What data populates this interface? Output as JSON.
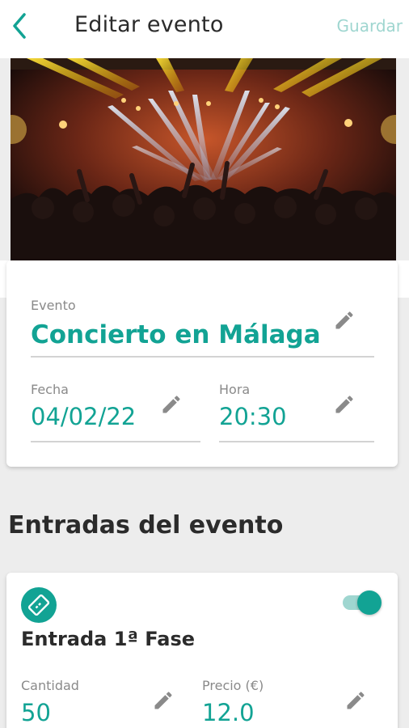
{
  "header": {
    "back_icon": "chevron-left-icon",
    "title": "Editar evento",
    "save_label": "Guardar"
  },
  "hero": {
    "alt": "concert-photo"
  },
  "event": {
    "name_label": "Evento",
    "name_value": "Concierto en Málaga",
    "date_label": "Fecha",
    "date_value": "04/02/22",
    "time_label": "Hora",
    "time_value": "20:30"
  },
  "tickets_section": {
    "title": "Entradas del evento",
    "tickets": [
      {
        "name": "Entrada 1ª Fase",
        "enabled": true,
        "quantity_label": "Cantidad",
        "quantity_value": "50",
        "price_label": "Precio (€)",
        "price_value": "12.0"
      }
    ]
  },
  "colors": {
    "accent": "#12a394",
    "accent_light": "#9fd6d0",
    "text": "#2b2b2b",
    "muted": "#8a8a8a"
  }
}
